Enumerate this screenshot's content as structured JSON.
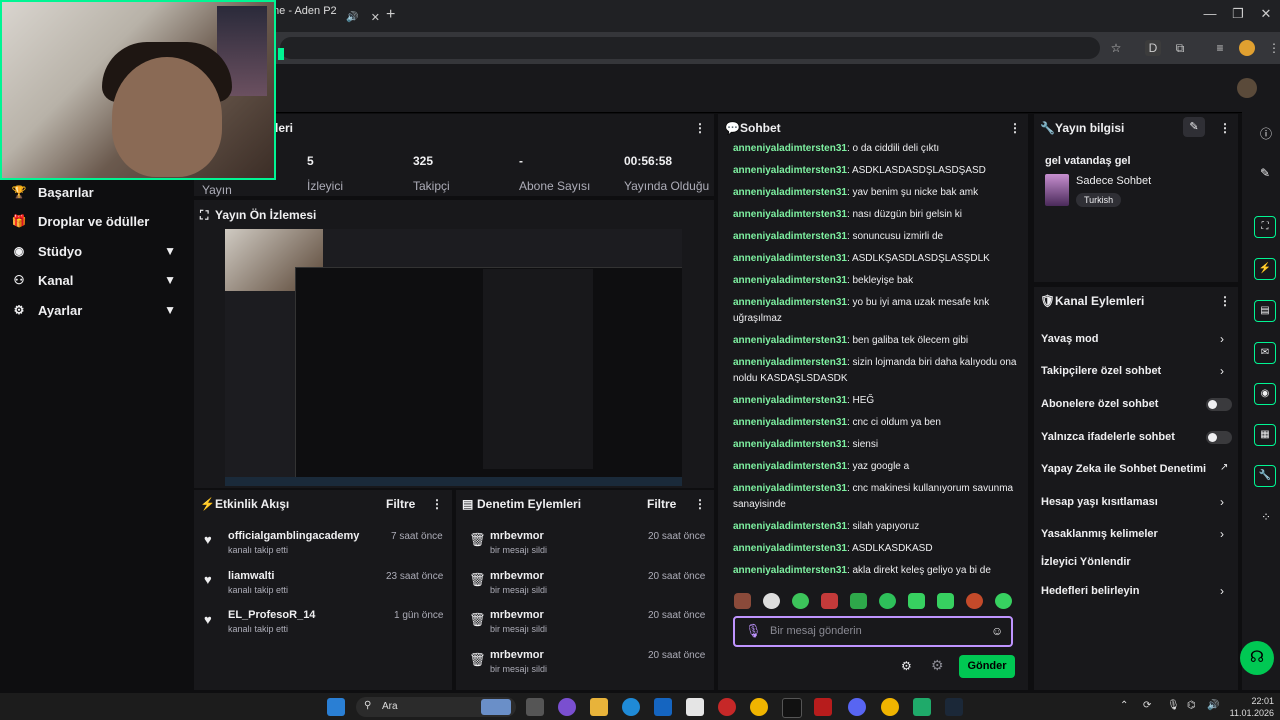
{
  "browser": {
    "tab_title": "me - Aden P2 (",
    "tab_close": "✕",
    "new_tab": "+",
    "win_min": "—",
    "win_max": "❐",
    "win_close": "✕"
  },
  "sidebar": {
    "items": [
      {
        "label": "Başarılar",
        "icon": "trophy-icon"
      },
      {
        "label": "Droplar ve ödüller",
        "icon": "gift-icon"
      },
      {
        "label": "Stüdyo",
        "icon": "studio-icon",
        "expandable": true
      },
      {
        "label": "Kanal",
        "icon": "channel-icon",
        "expandable": true
      },
      {
        "label": "Ayarlar",
        "icon": "gear-icon",
        "expandable": true
      }
    ]
  },
  "stats": {
    "title": "tikleri",
    "items": [
      {
        "value": "",
        "label": "Yayın"
      },
      {
        "value": "5",
        "label": "İzleyici"
      },
      {
        "value": "325",
        "label": "Takipçi"
      },
      {
        "value": "-",
        "label": "Abone Sayısı"
      },
      {
        "value": "00:56:58",
        "label": "Yayında Olduğu"
      }
    ]
  },
  "preview": {
    "title": "Yayın Ön İzlemesi"
  },
  "activity": {
    "title": "Etkinlik Akışı",
    "filter": "Filtre",
    "items": [
      {
        "name": "officialgamblingacademy",
        "sub": "kanalı takip etti",
        "time": "7 saat önce"
      },
      {
        "name": "liamwalti",
        "sub": "kanalı takip etti",
        "time": "23 saat önce"
      },
      {
        "name": "EL_ProfesoR_14",
        "sub": "kanalı takip etti",
        "time": "1 gün önce"
      }
    ]
  },
  "moderation": {
    "title": "Denetim Eylemleri",
    "filter": "Filtre",
    "items": [
      {
        "name": "mrbevmor",
        "sub": "bir mesajı sildi",
        "time": "20 saat önce"
      },
      {
        "name": "mrbevmor",
        "sub": "bir mesajı sildi",
        "time": "20 saat önce"
      },
      {
        "name": "mrbevmor",
        "sub": "bir mesajı sildi",
        "time": "20 saat önce"
      },
      {
        "name": "mrbevmor",
        "sub": "bir mesajı sildi",
        "time": "20 saat önce"
      }
    ]
  },
  "chat": {
    "title": "Sohbet",
    "placeholder": "Bir mesaj gönderin",
    "send": "Gönder",
    "messages": [
      {
        "user": "anneniyaladimtersten31",
        "text": "o da ciddili deli çıktı"
      },
      {
        "user": "anneniyaladimtersten31",
        "text": "ASDKLASDASDŞLASDŞASD"
      },
      {
        "user": "anneniyaladimtersten31",
        "text": "yav benim şu nicke bak amk"
      },
      {
        "user": "anneniyaladimtersten31",
        "text": "nası düzgün biri gelsin ki"
      },
      {
        "user": "anneniyaladimtersten31",
        "text": "sonuncusu izmirli de"
      },
      {
        "user": "anneniyaladimtersten31",
        "text": "ASDLKŞASDLASDŞLASŞDLK"
      },
      {
        "user": "anneniyaladimtersten31",
        "text": "bekleyişe bak"
      },
      {
        "user": "anneniyaladimtersten31",
        "text": "yo bu iyi ama uzak mesafe knk uğraşılmaz"
      },
      {
        "user": "anneniyaladimtersten31",
        "text": "ben galiba tek ölecem gibi"
      },
      {
        "user": "anneniyaladimtersten31",
        "text": "sizin lojmanda biri daha kalıyodu ona noldu KASDAŞLSDASDK"
      },
      {
        "user": "anneniyaladimtersten31",
        "text": "HEĞ"
      },
      {
        "user": "anneniyaladimtersten31",
        "text": "cnc ci oldum ya ben"
      },
      {
        "user": "anneniyaladimtersten31",
        "text": "siensi"
      },
      {
        "user": "anneniyaladimtersten31",
        "text": "yaz google a"
      },
      {
        "user": "anneniyaladimtersten31",
        "text": "cnc makinesi kullanıyorum savunma sanayisinde"
      },
      {
        "user": "anneniyaladimtersten31",
        "text": "silah yapıyoruz"
      },
      {
        "user": "anneniyaladimtersten31",
        "text": "ASDLKASDKASD"
      },
      {
        "user": "anneniyaladimtersten31",
        "text": "akla direkt keleş geliyo ya bi de"
      }
    ]
  },
  "stream_info": {
    "title": "Yayın bilgisi",
    "stream_title": "gel vatandaş gel",
    "category": "Sadece Sohbet",
    "tag": "Turkish"
  },
  "channel_actions": {
    "title": "Kanal Eylemleri",
    "items": [
      {
        "label": "Yavaş mod",
        "control": "chevron"
      },
      {
        "label": "Takipçilere özel sohbet",
        "control": "chevron"
      },
      {
        "label": "Abonelere özel sohbet",
        "control": "toggle"
      },
      {
        "label": "Yalnızca ifadelerle sohbet",
        "control": "toggle"
      },
      {
        "label": "Yapay Zeka ile Sohbet Denetimi",
        "control": "external"
      },
      {
        "label": "Hesap yaşı kısıtlaması",
        "control": "chevron"
      },
      {
        "label": "Yasaklanmış kelimeler",
        "control": "chevron"
      },
      {
        "label": "İzleyici Yönlendir",
        "control": "none"
      },
      {
        "label": "Hedefleri belirleyin",
        "control": "chevron"
      }
    ]
  },
  "taskbar": {
    "search": "Ara",
    "time": "22:01",
    "date": "11.01.2026"
  },
  "colors": {
    "accent": "#00f593",
    "chat_user": "#7ef0a1",
    "send": "#00c853",
    "input_border": "#bf94ff"
  }
}
